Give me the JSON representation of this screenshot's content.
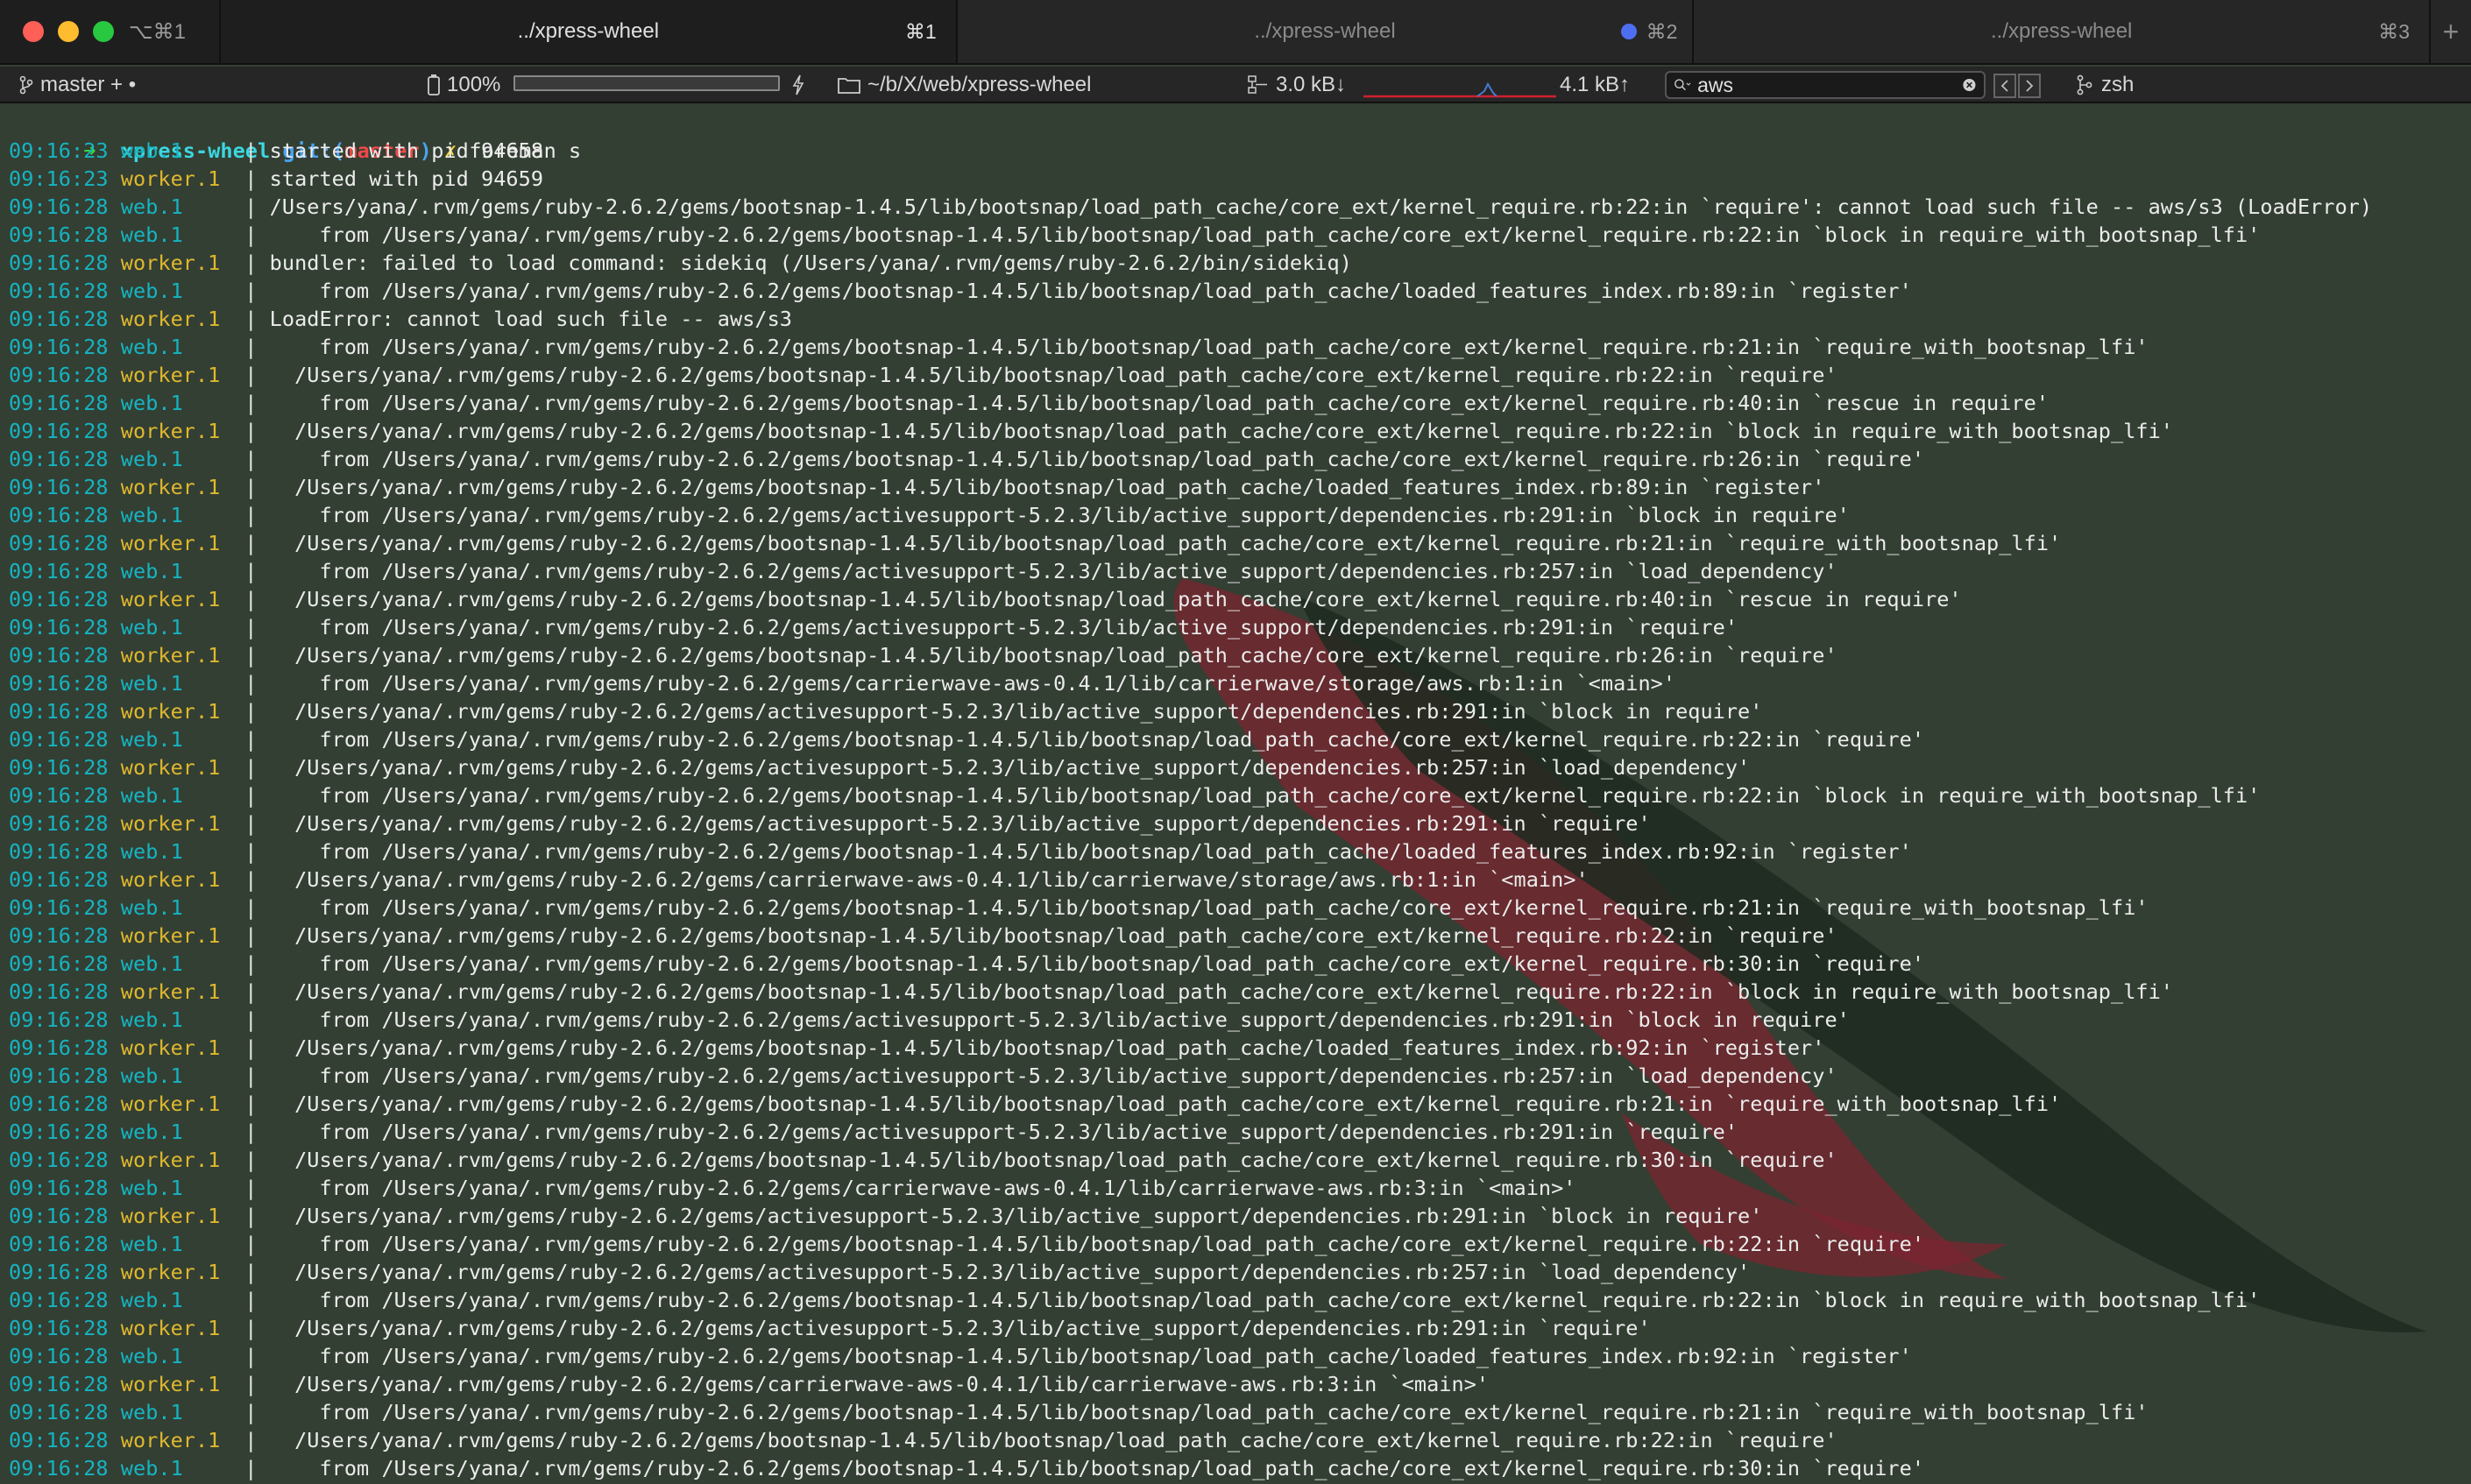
{
  "window": {
    "shortcut": "⌥⌘1"
  },
  "tabs": [
    {
      "label": "../xpress-wheel",
      "shortcut": "⌘1",
      "active": true
    },
    {
      "label": "../xpress-wheel",
      "shortcut": "⌘2",
      "active": false,
      "activity_dot_color": "#4e6ef2"
    },
    {
      "label": "../xpress-wheel",
      "shortcut": "⌘3",
      "active": false
    }
  ],
  "new_tab_label": "+",
  "status": {
    "git_branch": "master + •",
    "battery": "100%",
    "battery_level": 1.0,
    "path": "~/b/X/web/xpress-wheel",
    "net_down": "3.0 kB↓",
    "net_up": "4.1 kB↑",
    "search_value": "aws",
    "shell": "zsh"
  },
  "colors": {
    "timestamp": "#16b4c2",
    "web_process": "#16b4c2",
    "worker_process": "#e0b82e",
    "terminal_bg": "#333f33"
  },
  "prompt": {
    "arrow": "➜",
    "dir": "xpress-wheel",
    "git_prefix": "git:(",
    "branch": "master",
    "git_suffix": ")",
    "dirty": "✗",
    "command": "foreman s"
  },
  "log": [
    {
      "ts": "09:16:23",
      "proc": "web.1",
      "msg": "started with pid 94658"
    },
    {
      "ts": "09:16:23",
      "proc": "worker.1",
      "msg": "started with pid 94659"
    },
    {
      "ts": "09:16:28",
      "proc": "web.1",
      "msg": "/Users/yana/.rvm/gems/ruby-2.6.2/gems/bootsnap-1.4.5/lib/bootsnap/load_path_cache/core_ext/kernel_require.rb:22:in `require': cannot load such file -- aws/s3 (LoadError)"
    },
    {
      "ts": "09:16:28",
      "proc": "web.1",
      "msg": "    from /Users/yana/.rvm/gems/ruby-2.6.2/gems/bootsnap-1.4.5/lib/bootsnap/load_path_cache/core_ext/kernel_require.rb:22:in `block in require_with_bootsnap_lfi'"
    },
    {
      "ts": "09:16:28",
      "proc": "worker.1",
      "msg": "bundler: failed to load command: sidekiq (/Users/yana/.rvm/gems/ruby-2.6.2/bin/sidekiq)"
    },
    {
      "ts": "09:16:28",
      "proc": "web.1",
      "msg": "    from /Users/yana/.rvm/gems/ruby-2.6.2/gems/bootsnap-1.4.5/lib/bootsnap/load_path_cache/loaded_features_index.rb:89:in `register'"
    },
    {
      "ts": "09:16:28",
      "proc": "worker.1",
      "msg": "LoadError: cannot load such file -- aws/s3"
    },
    {
      "ts": "09:16:28",
      "proc": "web.1",
      "msg": "    from /Users/yana/.rvm/gems/ruby-2.6.2/gems/bootsnap-1.4.5/lib/bootsnap/load_path_cache/core_ext/kernel_require.rb:21:in `require_with_bootsnap_lfi'"
    },
    {
      "ts": "09:16:28",
      "proc": "worker.1",
      "msg": "  /Users/yana/.rvm/gems/ruby-2.6.2/gems/bootsnap-1.4.5/lib/bootsnap/load_path_cache/core_ext/kernel_require.rb:22:in `require'"
    },
    {
      "ts": "09:16:28",
      "proc": "web.1",
      "msg": "    from /Users/yana/.rvm/gems/ruby-2.6.2/gems/bootsnap-1.4.5/lib/bootsnap/load_path_cache/core_ext/kernel_require.rb:40:in `rescue in require'"
    },
    {
      "ts": "09:16:28",
      "proc": "worker.1",
      "msg": "  /Users/yana/.rvm/gems/ruby-2.6.2/gems/bootsnap-1.4.5/lib/bootsnap/load_path_cache/core_ext/kernel_require.rb:22:in `block in require_with_bootsnap_lfi'"
    },
    {
      "ts": "09:16:28",
      "proc": "web.1",
      "msg": "    from /Users/yana/.rvm/gems/ruby-2.6.2/gems/bootsnap-1.4.5/lib/bootsnap/load_path_cache/core_ext/kernel_require.rb:26:in `require'"
    },
    {
      "ts": "09:16:28",
      "proc": "worker.1",
      "msg": "  /Users/yana/.rvm/gems/ruby-2.6.2/gems/bootsnap-1.4.5/lib/bootsnap/load_path_cache/loaded_features_index.rb:89:in `register'"
    },
    {
      "ts": "09:16:28",
      "proc": "web.1",
      "msg": "    from /Users/yana/.rvm/gems/ruby-2.6.2/gems/activesupport-5.2.3/lib/active_support/dependencies.rb:291:in `block in require'"
    },
    {
      "ts": "09:16:28",
      "proc": "worker.1",
      "msg": "  /Users/yana/.rvm/gems/ruby-2.6.2/gems/bootsnap-1.4.5/lib/bootsnap/load_path_cache/core_ext/kernel_require.rb:21:in `require_with_bootsnap_lfi'"
    },
    {
      "ts": "09:16:28",
      "proc": "web.1",
      "msg": "    from /Users/yana/.rvm/gems/ruby-2.6.2/gems/activesupport-5.2.3/lib/active_support/dependencies.rb:257:in `load_dependency'"
    },
    {
      "ts": "09:16:28",
      "proc": "worker.1",
      "msg": "  /Users/yana/.rvm/gems/ruby-2.6.2/gems/bootsnap-1.4.5/lib/bootsnap/load_path_cache/core_ext/kernel_require.rb:40:in `rescue in require'"
    },
    {
      "ts": "09:16:28",
      "proc": "web.1",
      "msg": "    from /Users/yana/.rvm/gems/ruby-2.6.2/gems/activesupport-5.2.3/lib/active_support/dependencies.rb:291:in `require'"
    },
    {
      "ts": "09:16:28",
      "proc": "worker.1",
      "msg": "  /Users/yana/.rvm/gems/ruby-2.6.2/gems/bootsnap-1.4.5/lib/bootsnap/load_path_cache/core_ext/kernel_require.rb:26:in `require'"
    },
    {
      "ts": "09:16:28",
      "proc": "web.1",
      "msg": "    from /Users/yana/.rvm/gems/ruby-2.6.2/gems/carrierwave-aws-0.4.1/lib/carrierwave/storage/aws.rb:1:in `<main>'"
    },
    {
      "ts": "09:16:28",
      "proc": "worker.1",
      "msg": "  /Users/yana/.rvm/gems/ruby-2.6.2/gems/activesupport-5.2.3/lib/active_support/dependencies.rb:291:in `block in require'"
    },
    {
      "ts": "09:16:28",
      "proc": "web.1",
      "msg": "    from /Users/yana/.rvm/gems/ruby-2.6.2/gems/bootsnap-1.4.5/lib/bootsnap/load_path_cache/core_ext/kernel_require.rb:22:in `require'"
    },
    {
      "ts": "09:16:28",
      "proc": "worker.1",
      "msg": "  /Users/yana/.rvm/gems/ruby-2.6.2/gems/activesupport-5.2.3/lib/active_support/dependencies.rb:257:in `load_dependency'"
    },
    {
      "ts": "09:16:28",
      "proc": "web.1",
      "msg": "    from /Users/yana/.rvm/gems/ruby-2.6.2/gems/bootsnap-1.4.5/lib/bootsnap/load_path_cache/core_ext/kernel_require.rb:22:in `block in require_with_bootsnap_lfi'"
    },
    {
      "ts": "09:16:28",
      "proc": "worker.1",
      "msg": "  /Users/yana/.rvm/gems/ruby-2.6.2/gems/activesupport-5.2.3/lib/active_support/dependencies.rb:291:in `require'"
    },
    {
      "ts": "09:16:28",
      "proc": "web.1",
      "msg": "    from /Users/yana/.rvm/gems/ruby-2.6.2/gems/bootsnap-1.4.5/lib/bootsnap/load_path_cache/loaded_features_index.rb:92:in `register'"
    },
    {
      "ts": "09:16:28",
      "proc": "worker.1",
      "msg": "  /Users/yana/.rvm/gems/ruby-2.6.2/gems/carrierwave-aws-0.4.1/lib/carrierwave/storage/aws.rb:1:in `<main>'"
    },
    {
      "ts": "09:16:28",
      "proc": "web.1",
      "msg": "    from /Users/yana/.rvm/gems/ruby-2.6.2/gems/bootsnap-1.4.5/lib/bootsnap/load_path_cache/core_ext/kernel_require.rb:21:in `require_with_bootsnap_lfi'"
    },
    {
      "ts": "09:16:28",
      "proc": "worker.1",
      "msg": "  /Users/yana/.rvm/gems/ruby-2.6.2/gems/bootsnap-1.4.5/lib/bootsnap/load_path_cache/core_ext/kernel_require.rb:22:in `require'"
    },
    {
      "ts": "09:16:28",
      "proc": "web.1",
      "msg": "    from /Users/yana/.rvm/gems/ruby-2.6.2/gems/bootsnap-1.4.5/lib/bootsnap/load_path_cache/core_ext/kernel_require.rb:30:in `require'"
    },
    {
      "ts": "09:16:28",
      "proc": "worker.1",
      "msg": "  /Users/yana/.rvm/gems/ruby-2.6.2/gems/bootsnap-1.4.5/lib/bootsnap/load_path_cache/core_ext/kernel_require.rb:22:in `block in require_with_bootsnap_lfi'"
    },
    {
      "ts": "09:16:28",
      "proc": "web.1",
      "msg": "    from /Users/yana/.rvm/gems/ruby-2.6.2/gems/activesupport-5.2.3/lib/active_support/dependencies.rb:291:in `block in require'"
    },
    {
      "ts": "09:16:28",
      "proc": "worker.1",
      "msg": "  /Users/yana/.rvm/gems/ruby-2.6.2/gems/bootsnap-1.4.5/lib/bootsnap/load_path_cache/loaded_features_index.rb:92:in `register'"
    },
    {
      "ts": "09:16:28",
      "proc": "web.1",
      "msg": "    from /Users/yana/.rvm/gems/ruby-2.6.2/gems/activesupport-5.2.3/lib/active_support/dependencies.rb:257:in `load_dependency'"
    },
    {
      "ts": "09:16:28",
      "proc": "worker.1",
      "msg": "  /Users/yana/.rvm/gems/ruby-2.6.2/gems/bootsnap-1.4.5/lib/bootsnap/load_path_cache/core_ext/kernel_require.rb:21:in `require_with_bootsnap_lfi'"
    },
    {
      "ts": "09:16:28",
      "proc": "web.1",
      "msg": "    from /Users/yana/.rvm/gems/ruby-2.6.2/gems/activesupport-5.2.3/lib/active_support/dependencies.rb:291:in `require'"
    },
    {
      "ts": "09:16:28",
      "proc": "worker.1",
      "msg": "  /Users/yana/.rvm/gems/ruby-2.6.2/gems/bootsnap-1.4.5/lib/bootsnap/load_path_cache/core_ext/kernel_require.rb:30:in `require'"
    },
    {
      "ts": "09:16:28",
      "proc": "web.1",
      "msg": "    from /Users/yana/.rvm/gems/ruby-2.6.2/gems/carrierwave-aws-0.4.1/lib/carrierwave-aws.rb:3:in `<main>'"
    },
    {
      "ts": "09:16:28",
      "proc": "worker.1",
      "msg": "  /Users/yana/.rvm/gems/ruby-2.6.2/gems/activesupport-5.2.3/lib/active_support/dependencies.rb:291:in `block in require'"
    },
    {
      "ts": "09:16:28",
      "proc": "web.1",
      "msg": "    from /Users/yana/.rvm/gems/ruby-2.6.2/gems/bootsnap-1.4.5/lib/bootsnap/load_path_cache/core_ext/kernel_require.rb:22:in `require'"
    },
    {
      "ts": "09:16:28",
      "proc": "worker.1",
      "msg": "  /Users/yana/.rvm/gems/ruby-2.6.2/gems/activesupport-5.2.3/lib/active_support/dependencies.rb:257:in `load_dependency'"
    },
    {
      "ts": "09:16:28",
      "proc": "web.1",
      "msg": "    from /Users/yana/.rvm/gems/ruby-2.6.2/gems/bootsnap-1.4.5/lib/bootsnap/load_path_cache/core_ext/kernel_require.rb:22:in `block in require_with_bootsnap_lfi'"
    },
    {
      "ts": "09:16:28",
      "proc": "worker.1",
      "msg": "  /Users/yana/.rvm/gems/ruby-2.6.2/gems/activesupport-5.2.3/lib/active_support/dependencies.rb:291:in `require'"
    },
    {
      "ts": "09:16:28",
      "proc": "web.1",
      "msg": "    from /Users/yana/.rvm/gems/ruby-2.6.2/gems/bootsnap-1.4.5/lib/bootsnap/load_path_cache/loaded_features_index.rb:92:in `register'"
    },
    {
      "ts": "09:16:28",
      "proc": "worker.1",
      "msg": "  /Users/yana/.rvm/gems/ruby-2.6.2/gems/carrierwave-aws-0.4.1/lib/carrierwave-aws.rb:3:in `<main>'"
    },
    {
      "ts": "09:16:28",
      "proc": "web.1",
      "msg": "    from /Users/yana/.rvm/gems/ruby-2.6.2/gems/bootsnap-1.4.5/lib/bootsnap/load_path_cache/core_ext/kernel_require.rb:21:in `require_with_bootsnap_lfi'"
    },
    {
      "ts": "09:16:28",
      "proc": "worker.1",
      "msg": "  /Users/yana/.rvm/gems/ruby-2.6.2/gems/bootsnap-1.4.5/lib/bootsnap/load_path_cache/core_ext/kernel_require.rb:22:in `require'"
    },
    {
      "ts": "09:16:28",
      "proc": "web.1",
      "msg": "    from /Users/yana/.rvm/gems/ruby-2.6.2/gems/bootsnap-1.4.5/lib/bootsnap/load_path_cache/core_ext/kernel_require.rb:30:in `require'"
    }
  ]
}
